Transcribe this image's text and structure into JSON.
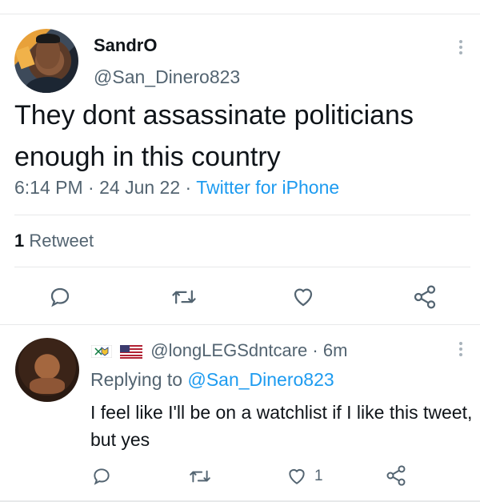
{
  "tweet": {
    "display_name": "SandrO",
    "handle": "@San_Dinero823",
    "text": "They dont assassinate politicians enough in this country",
    "time": "6:14 PM",
    "separator": "·",
    "date": "24 Jun 22",
    "source": "Twitter for iPhone",
    "retweet_count": "1",
    "retweet_label": "Retweet"
  },
  "reply": {
    "handle": "@longLEGSdntcare",
    "separator": "·",
    "time": "6m",
    "replying_prefix": "Replying to",
    "replying_handle": "@San_Dinero823",
    "text": "I feel like I'll be on a watchlist if I like this tweet, but yes",
    "like_count": "1"
  },
  "icons": [
    "reply-icon",
    "retweet-icon",
    "like-icon",
    "share-icon",
    "more-options-icon"
  ],
  "colors": {
    "link": "#1d9bf0",
    "secondary": "#536471",
    "primary": "#0f1419",
    "divider": "#e7e9ea"
  }
}
